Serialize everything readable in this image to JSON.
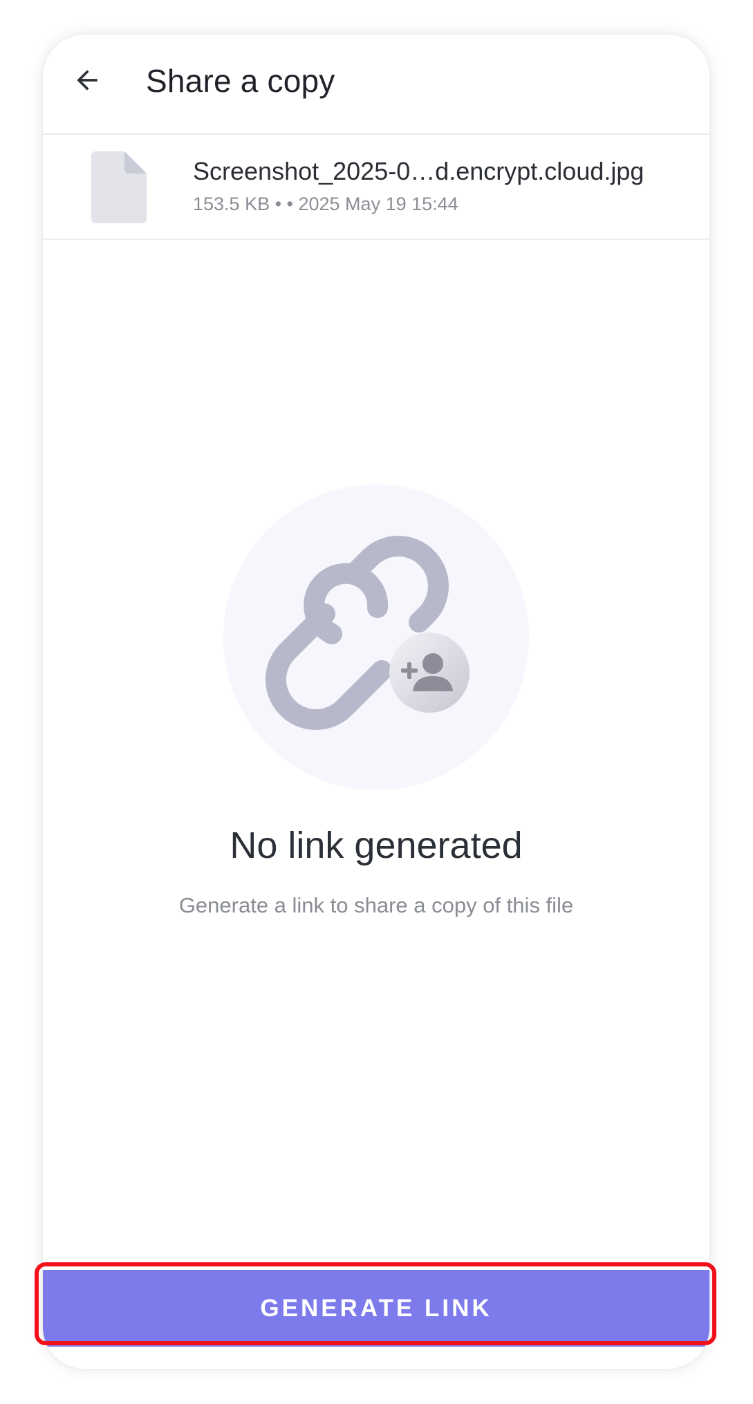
{
  "header": {
    "title": "Share a copy",
    "back_icon": "arrow-left-icon"
  },
  "file": {
    "icon": "file-icon",
    "name": "Screenshot_2025-0…d.encrypt.cloud.jpg",
    "meta": "153.5 KB •  • 2025 May 19 15:44"
  },
  "empty_state": {
    "illustration": "link-add-person-icon",
    "title": "No link generated",
    "subtitle": "Generate a link to share a copy of this file"
  },
  "actions": {
    "generate_label": "GENERATE LINK"
  },
  "colors": {
    "accent": "#7d7bec",
    "highlight": "#f2101a",
    "illustration_bg": "#f6f6fc"
  }
}
